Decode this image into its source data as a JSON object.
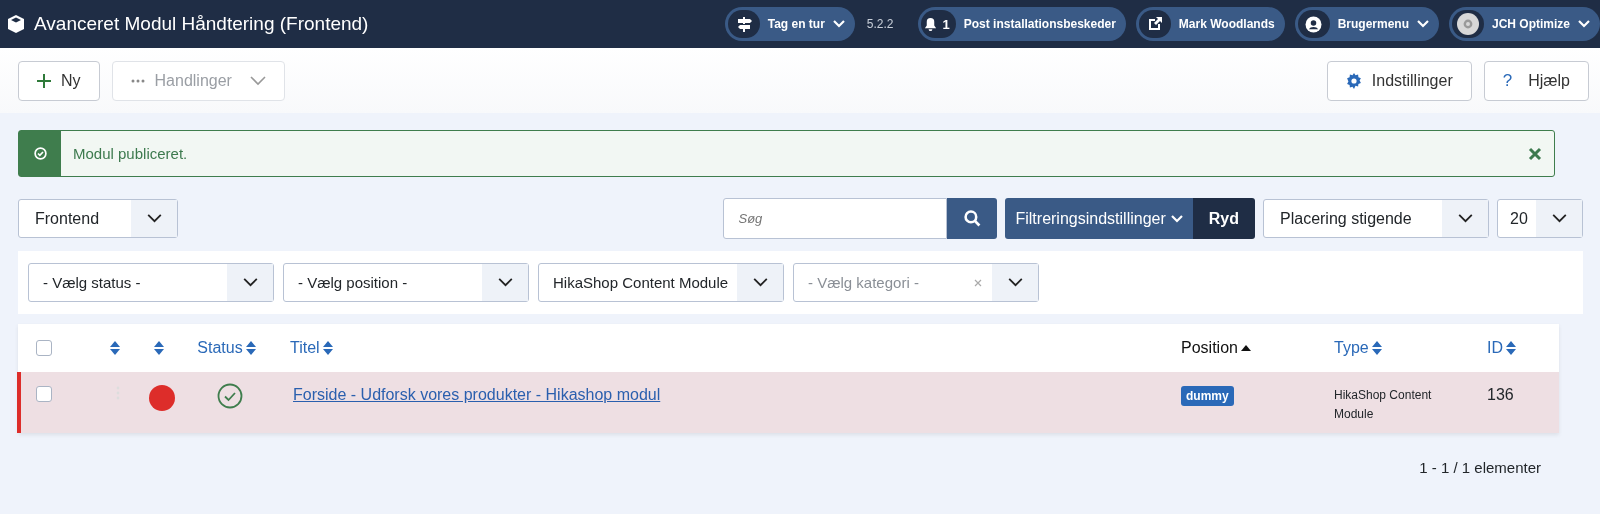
{
  "header": {
    "title": "Avanceret Modul Håndtering (Frontend)",
    "items": [
      {
        "kind": "tour",
        "label": "Tag en tur",
        "caret": true
      },
      {
        "kind": "version",
        "label": "5.2.2"
      },
      {
        "kind": "notify",
        "count": "1",
        "label": "Post installationsbeskeder"
      },
      {
        "kind": "link",
        "label": "Mark Woodlands"
      },
      {
        "kind": "user",
        "label": "Brugermenu",
        "caret": true
      },
      {
        "kind": "plugin",
        "label": "JCH Optimize",
        "caret": true
      }
    ]
  },
  "toolbar": {
    "left": [
      {
        "kind": "new",
        "label": "Ny",
        "disabled": false
      },
      {
        "kind": "actions",
        "label": "Handlinger",
        "disabled": true
      }
    ],
    "right": [
      {
        "kind": "options",
        "label": "Indstillinger"
      },
      {
        "kind": "help",
        "icon": "?",
        "label": "Hjælp"
      }
    ]
  },
  "alert": {
    "message": "Modul publiceret."
  },
  "filters": {
    "client": "Frontend",
    "search": {
      "placeholder": "Søg"
    },
    "filter_button": "Filtreringsindstillinger",
    "clear_button": "Ryd",
    "ordering": "Placering stigende",
    "limit": "20",
    "selects": [
      {
        "value": "- Vælg status -"
      },
      {
        "value": "- Vælg position -"
      },
      {
        "value": "HikaShop Content Module"
      },
      {
        "placeholder": "- Vælg kategori -",
        "clearable": true
      }
    ]
  },
  "table": {
    "columns": [
      {
        "kind": "check",
        "checked": false
      },
      {
        "kind": "sort",
        "active": false
      },
      {
        "kind": "sort",
        "active": false
      },
      {
        "kind": "sort",
        "label": "Status",
        "active": false
      },
      {
        "kind": "sort",
        "label": "Titel",
        "active": false
      },
      {
        "kind": "sort",
        "label": "Position",
        "active": true
      },
      {
        "kind": "sort",
        "label": "Type",
        "active": false
      },
      {
        "kind": "sort",
        "label": "ID",
        "active": false
      }
    ],
    "rows": [
      {
        "checked": false,
        "color": "#dd2d2a",
        "published": true,
        "title": "Forside - Udforsk vores produkter - Hikashop modul",
        "position": "dummy",
        "type": "HikaShop Content Module",
        "id": "136"
      }
    ]
  },
  "pagination": "1 - 1 / 1 elementer"
}
